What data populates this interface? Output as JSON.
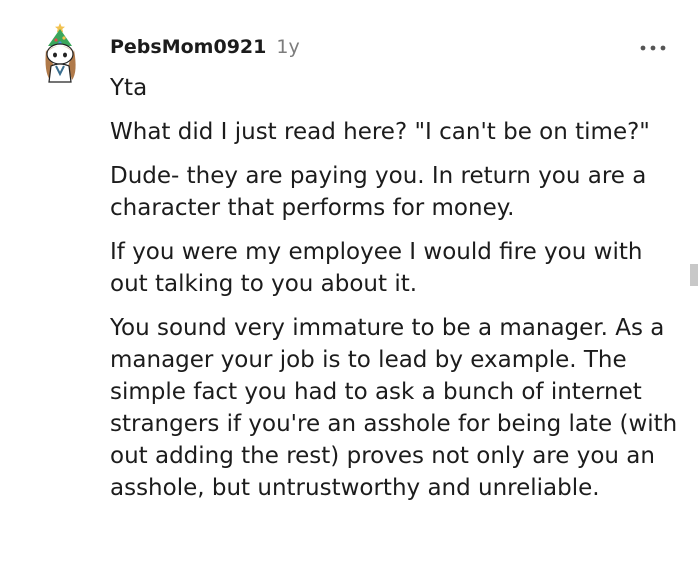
{
  "comment": {
    "username": "PebsMom0921",
    "age": "1y",
    "avatar_icon": "snoo-avatar-with-christmas-tree-hat-icon",
    "more_icon": "more-options-icon",
    "paragraphs": [
      "Yta",
      "What did I just read here? \"I can't be on time?\"",
      "Dude- they are paying you. In return you are a character that performs for money.",
      "If you were my employee I would fire you with out talking to you about it.",
      "You sound very immature to be a manager. As a manager your job is to lead by example. The simple fact you had to ask a bunch of internet strangers if you're an asshole for being late (with out adding the rest) proves not only are you an asshole, but untrustworthy and unreliable."
    ]
  },
  "colors": {
    "text": "#1c1c1c",
    "meta": "#7c7c7c",
    "tree": "#3aa65b",
    "hair": "#b07a4a"
  }
}
